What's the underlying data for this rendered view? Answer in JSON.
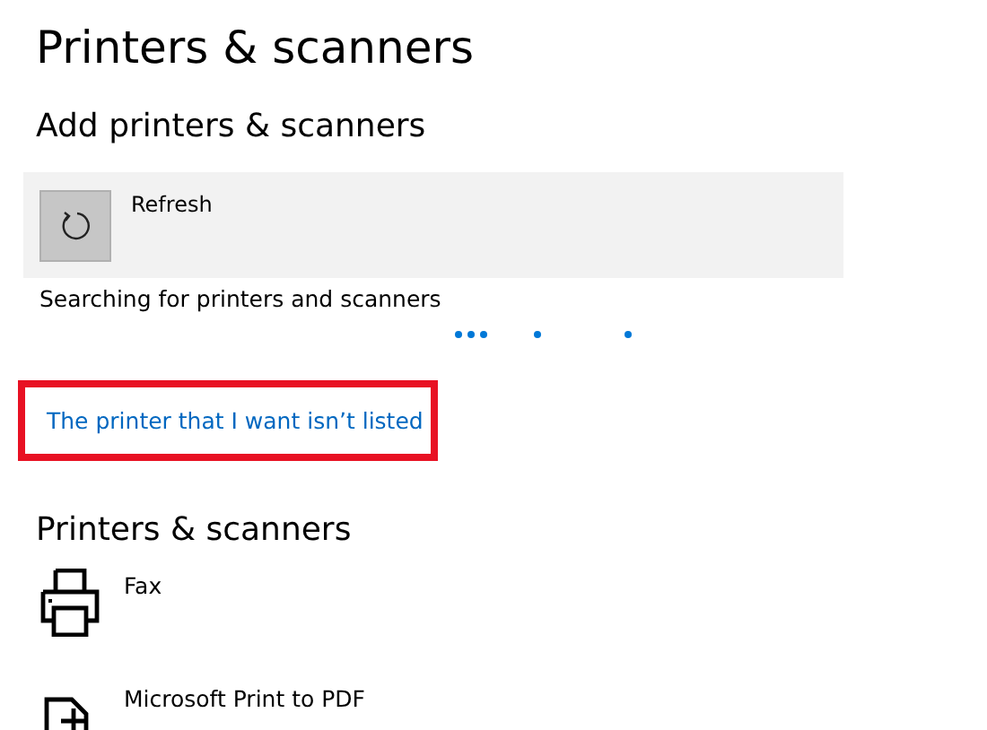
{
  "page_title": "Printers & scanners",
  "add_section": {
    "heading": "Add printers & scanners",
    "refresh_label": "Refresh",
    "status": "Searching for printers and scanners"
  },
  "link": {
    "label": "The printer that I want isn’t listed",
    "highlighted": true
  },
  "devices_section": {
    "heading": "Printers & scanners",
    "devices": [
      {
        "kind": "printer",
        "name": "Fax"
      },
      {
        "kind": "pdf",
        "name": "Microsoft Print to PDF"
      }
    ]
  }
}
